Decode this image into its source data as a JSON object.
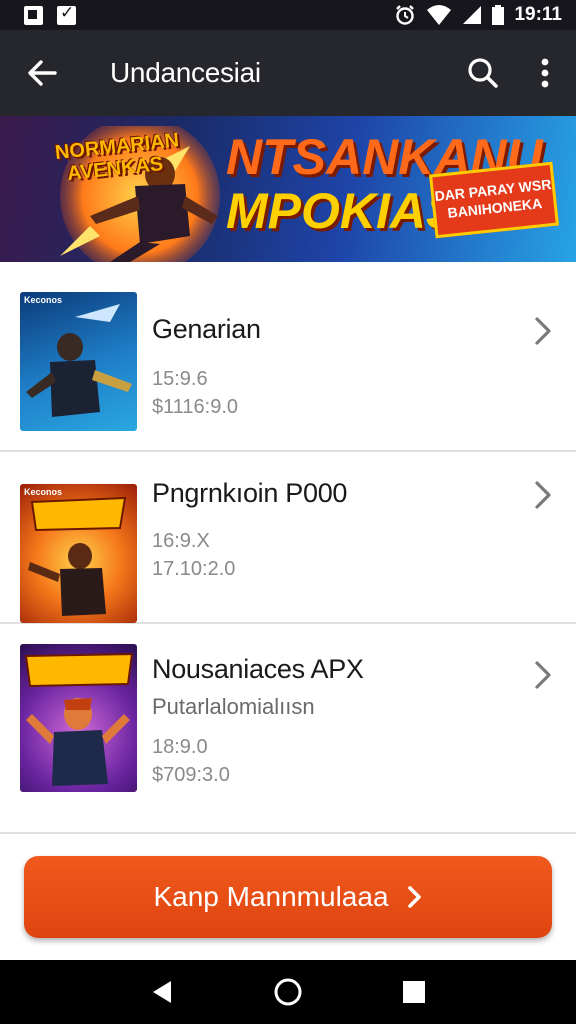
{
  "status_bar": {
    "time": "19:11",
    "icons": [
      "notification-icon",
      "checkbox-icon",
      "alarm-icon",
      "wifi-icon",
      "signal-icon",
      "battery-icon"
    ]
  },
  "app_bar": {
    "title": "Undancesiai",
    "icons": [
      "back-arrow-icon",
      "search-icon",
      "more-vert-icon"
    ]
  },
  "banner": {
    "logo_text": "NORMARIAN AVENKAS",
    "headline_line1": "NTSANKANU",
    "headline_line2": "MPOKIAS",
    "badge_text": "DAR PARAY WSR BANIHONEKA"
  },
  "items": [
    {
      "title": "Genarian",
      "subtitle": "",
      "line1": "15:9.6",
      "line2": "$1116:9.0",
      "thumb_tag": "Keconos",
      "thumb_colors": [
        "#0b3b7a",
        "#2aa7e0"
      ]
    },
    {
      "title": "Pngrnkıoin P000",
      "subtitle": "",
      "line1": "16:9.X",
      "line2": "17.10:2.0",
      "thumb_tag": "Keconos",
      "thumb_colors": [
        "#c23a0a",
        "#f5a623"
      ]
    },
    {
      "title": "Nousaniaces APX",
      "subtitle": "Putarlalomialıısn",
      "line1": "18:9.0",
      "line2": "$709:3.0",
      "thumb_tag": "",
      "thumb_colors": [
        "#3a1160",
        "#8a2bb8"
      ]
    }
  ],
  "cta": {
    "label": "Kanp Mannmulaaa",
    "icon": "chevron-right-icon"
  },
  "nav_bar": {
    "icons": [
      "back-triangle-icon",
      "home-circle-icon",
      "recents-square-icon"
    ]
  },
  "colors": {
    "status_bar": "#16161c",
    "app_bar": "#26262d",
    "accent": "#e84e14",
    "chevron": "#7a7a7a"
  }
}
